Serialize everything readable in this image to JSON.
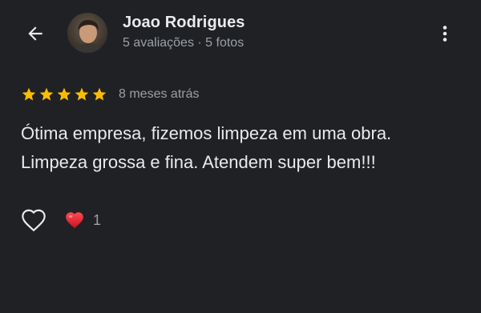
{
  "reviewer": {
    "name": "Joao Rodrigues",
    "meta": "5 avaliações · 5 fotos"
  },
  "review": {
    "rating": 5,
    "max_rating": 5,
    "date": "8 meses atrás",
    "text_lines": [
      "Ótima empresa, fizemos limpeza em uma obra.",
      "Limpeza grossa e fina. Atendem super bem!!!"
    ]
  },
  "reactions": {
    "heart_count": "1"
  },
  "icons": {
    "back": "arrow-back-icon",
    "more": "more-vert-icon",
    "star": "star-icon",
    "like": "heart-outline-icon",
    "reaction": "red-heart-icon"
  },
  "colors": {
    "background": "#202124",
    "primary_text": "#e8eaed",
    "secondary_text": "#9aa0a6",
    "star": "#fbbc04",
    "heart": "#e11d2e"
  }
}
